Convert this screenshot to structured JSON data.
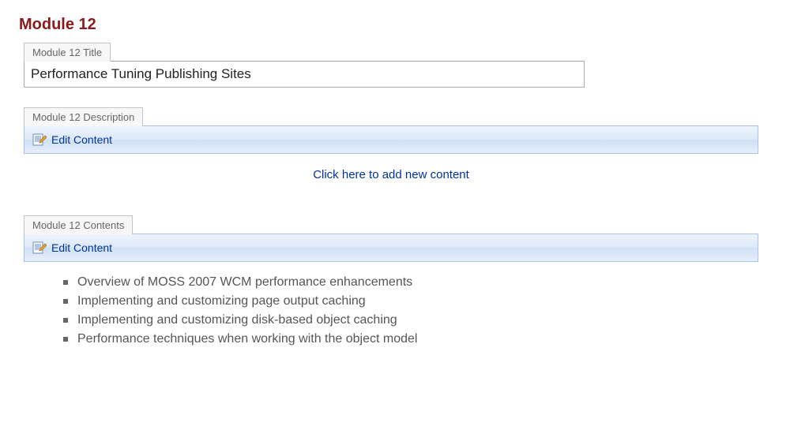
{
  "heading": "Module 12",
  "fields": {
    "title": {
      "label": "Module 12 Title",
      "value": "Performance Tuning Publishing Sites"
    },
    "description": {
      "label": "Module 12 Description",
      "edit_label": "Edit Content",
      "add_content_label": "Click here to add new content"
    },
    "contents": {
      "label": "Module 12 Contents",
      "edit_label": "Edit Content",
      "items": [
        "Overview of MOSS 2007 WCM performance enhancements",
        "Implementing and customizing page output caching",
        "Implementing and customizing disk-based object caching",
        "Performance techniques when working with the object model"
      ]
    }
  }
}
